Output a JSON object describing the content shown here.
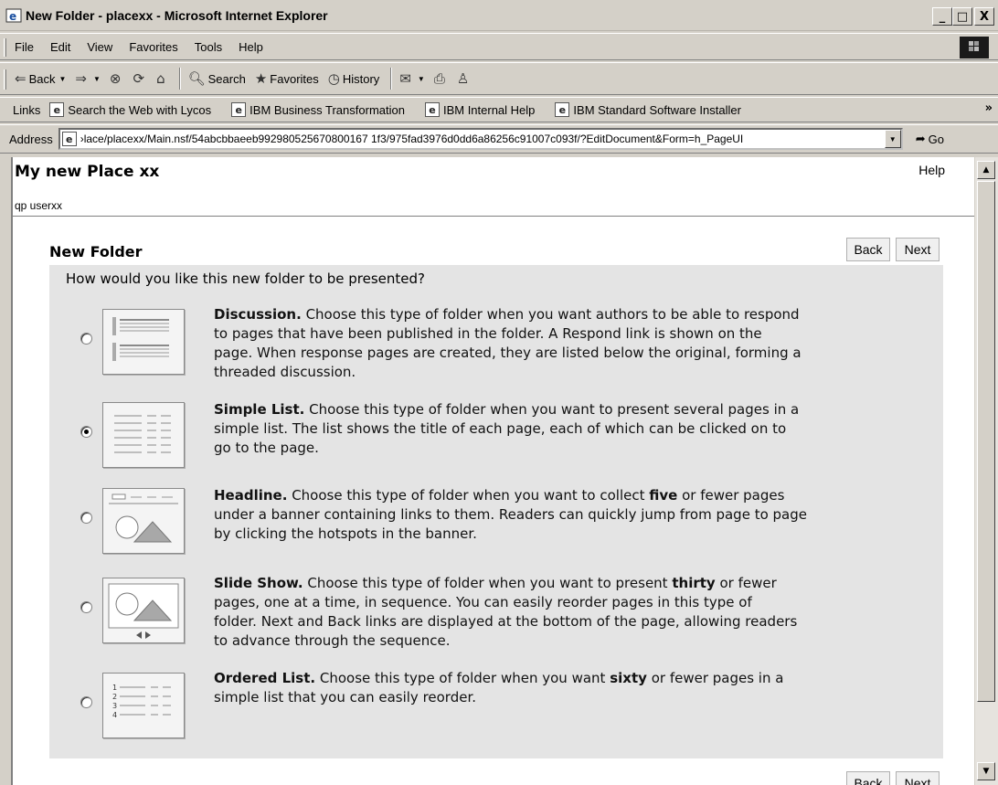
{
  "window": {
    "title": "New Folder - placexx - Microsoft Internet Explorer",
    "controls": [
      "_",
      "□",
      "X"
    ]
  },
  "menu": [
    "File",
    "Edit",
    "View",
    "Favorites",
    "Tools",
    "Help"
  ],
  "toolbar": {
    "back": "Back",
    "search": "Search",
    "favorites": "Favorites",
    "history": "History"
  },
  "links": {
    "label": "Links",
    "items": [
      "Search the Web with Lycos",
      "IBM Business Transformation",
      "IBM Internal Help",
      "IBM Standard Software Installer"
    ],
    "more": "»"
  },
  "address": {
    "label": "Address",
    "url": "›lace/placexx/Main.nsf/54abcbbaeeb992980525670800167 1f3/975fad3976d0dd6a86256c91007c093f/?EditDocument&Form=h_PageUI",
    "go": "Go"
  },
  "page": {
    "place_title": "My new Place xx",
    "help": "Help",
    "user": "qp userxx",
    "form_title": "New Folder",
    "back": "Back",
    "next": "Next",
    "question": "How would you like this new folder to be presented?",
    "options": [
      {
        "name": "Discussion.",
        "selected": false,
        "lines": [
          "Choose this type of folder when you want authors to be able to respond",
          "to pages that have been published in the folder. A Respond link is shown on the",
          "page. When response pages are created, they are listed below the original, forming a",
          "threaded discussion."
        ]
      },
      {
        "name": "Simple List.",
        "selected": true,
        "lines": [
          "Choose this type of folder when you want to present several pages in a",
          "simple list. The list shows the title of each page, each of which can be clicked on to",
          "go to the page."
        ]
      },
      {
        "name": "Headline.",
        "selected": false,
        "pre": "Choose this type of folder when you want to collect",
        "bold": "five",
        "post": "or fewer pages",
        "lines": [
          "under a banner containing links to them. Readers can quickly jump from page to page",
          "by clicking the hotspots in the banner."
        ]
      },
      {
        "name": "Slide Show.",
        "selected": false,
        "pre": "Choose this type of folder when you want to present",
        "bold": "thirty",
        "post": "or fewer",
        "lines": [
          "pages, one at a time, in sequence. You can easily reorder pages in this type of",
          "folder. Next and Back links are displayed at the bottom of the page, allowing readers",
          "to advance through the sequence."
        ]
      },
      {
        "name": "Ordered List.",
        "selected": false,
        "pre": "Choose this type of folder when you want",
        "bold": "sixty",
        "post": "or fewer pages in a",
        "lines": [
          "simple list that you can easily reorder."
        ]
      }
    ]
  }
}
